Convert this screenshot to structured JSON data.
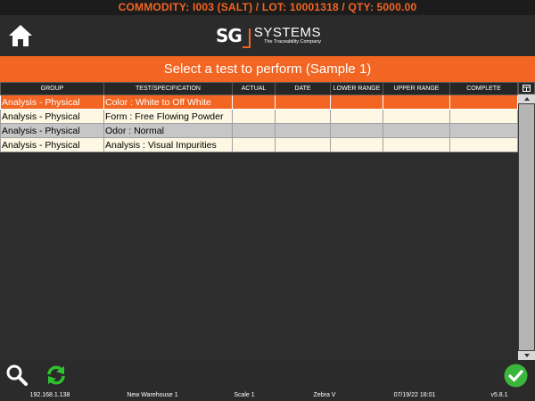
{
  "commodity_bar": {
    "text": "COMMODITY: I003 (SALT) / LOT: 10001318 / QTY: 5000.00"
  },
  "header": {
    "home_icon": "home-icon",
    "logo": {
      "sg": "SG",
      "name": "SYSTEMS",
      "tagline": "The Traceability Company"
    }
  },
  "title_bar": {
    "text": "Select a test to perform (Sample 1)"
  },
  "table": {
    "columns": [
      "GROUP",
      "TEST/SPECIFICATION",
      "ACTUAL",
      "DATE",
      "LOWER RANGE",
      "UPPER RANGE",
      "COMPLETE"
    ],
    "rows": [
      {
        "group": "Analysis - Physical",
        "test": "Color : White to Off White",
        "actual": "",
        "date": "",
        "lower": "",
        "upper": "",
        "complete": "",
        "style": "selected"
      },
      {
        "group": "Analysis - Physical",
        "test": "Form : Free Flowing Powder",
        "actual": "",
        "date": "",
        "lower": "",
        "upper": "",
        "complete": "",
        "style": "cream"
      },
      {
        "group": "Analysis - Physical",
        "test": "Odor : Normal",
        "actual": "",
        "date": "",
        "lower": "",
        "upper": "",
        "complete": "",
        "style": "gray"
      },
      {
        "group": "Analysis - Physical",
        "test": "Analysis : Visual Impurities",
        "actual": "",
        "date": "",
        "lower": "",
        "upper": "",
        "complete": "",
        "style": "cream"
      }
    ]
  },
  "toolbar": {
    "search_icon": "search-icon",
    "refresh_icon": "refresh-icon",
    "ok_icon": "check-icon"
  },
  "status_bar": {
    "ip": "192.168.1.138",
    "warehouse": "New Warehouse 1",
    "scale": "Scale 1",
    "printer": "Zebra V",
    "datetime": "07/19/22 18:01",
    "version": "v5.8.1"
  },
  "colors": {
    "accent": "#f26522",
    "background": "#2d2d2d",
    "selected_row": "#f26522",
    "cream_row": "#fdf7e3",
    "gray_row": "#c6c6c6",
    "ok_green": "#3cb53c",
    "refresh_green": "#2fc22f"
  }
}
